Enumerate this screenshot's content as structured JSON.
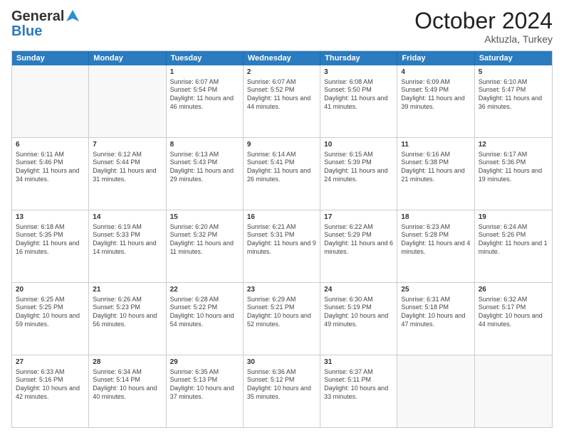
{
  "header": {
    "logo_text_general": "General",
    "logo_text_blue": "Blue",
    "month_title": "October 2024",
    "location": "Aktuzla, Turkey"
  },
  "calendar": {
    "days_of_week": [
      "Sunday",
      "Monday",
      "Tuesday",
      "Wednesday",
      "Thursday",
      "Friday",
      "Saturday"
    ],
    "weeks": [
      [
        {
          "day": "",
          "info": ""
        },
        {
          "day": "",
          "info": ""
        },
        {
          "day": "1",
          "info": "Sunrise: 6:07 AM\nSunset: 5:54 PM\nDaylight: 11 hours and 46 minutes."
        },
        {
          "day": "2",
          "info": "Sunrise: 6:07 AM\nSunset: 5:52 PM\nDaylight: 11 hours and 44 minutes."
        },
        {
          "day": "3",
          "info": "Sunrise: 6:08 AM\nSunset: 5:50 PM\nDaylight: 11 hours and 41 minutes."
        },
        {
          "day": "4",
          "info": "Sunrise: 6:09 AM\nSunset: 5:49 PM\nDaylight: 11 hours and 39 minutes."
        },
        {
          "day": "5",
          "info": "Sunrise: 6:10 AM\nSunset: 5:47 PM\nDaylight: 11 hours and 36 minutes."
        }
      ],
      [
        {
          "day": "6",
          "info": "Sunrise: 6:11 AM\nSunset: 5:46 PM\nDaylight: 11 hours and 34 minutes."
        },
        {
          "day": "7",
          "info": "Sunrise: 6:12 AM\nSunset: 5:44 PM\nDaylight: 11 hours and 31 minutes."
        },
        {
          "day": "8",
          "info": "Sunrise: 6:13 AM\nSunset: 5:43 PM\nDaylight: 11 hours and 29 minutes."
        },
        {
          "day": "9",
          "info": "Sunrise: 6:14 AM\nSunset: 5:41 PM\nDaylight: 11 hours and 26 minutes."
        },
        {
          "day": "10",
          "info": "Sunrise: 6:15 AM\nSunset: 5:39 PM\nDaylight: 11 hours and 24 minutes."
        },
        {
          "day": "11",
          "info": "Sunrise: 6:16 AM\nSunset: 5:38 PM\nDaylight: 11 hours and 21 minutes."
        },
        {
          "day": "12",
          "info": "Sunrise: 6:17 AM\nSunset: 5:36 PM\nDaylight: 11 hours and 19 minutes."
        }
      ],
      [
        {
          "day": "13",
          "info": "Sunrise: 6:18 AM\nSunset: 5:35 PM\nDaylight: 11 hours and 16 minutes."
        },
        {
          "day": "14",
          "info": "Sunrise: 6:19 AM\nSunset: 5:33 PM\nDaylight: 11 hours and 14 minutes."
        },
        {
          "day": "15",
          "info": "Sunrise: 6:20 AM\nSunset: 5:32 PM\nDaylight: 11 hours and 11 minutes."
        },
        {
          "day": "16",
          "info": "Sunrise: 6:21 AM\nSunset: 5:31 PM\nDaylight: 11 hours and 9 minutes."
        },
        {
          "day": "17",
          "info": "Sunrise: 6:22 AM\nSunset: 5:29 PM\nDaylight: 11 hours and 6 minutes."
        },
        {
          "day": "18",
          "info": "Sunrise: 6:23 AM\nSunset: 5:28 PM\nDaylight: 11 hours and 4 minutes."
        },
        {
          "day": "19",
          "info": "Sunrise: 6:24 AM\nSunset: 5:26 PM\nDaylight: 11 hours and 1 minute."
        }
      ],
      [
        {
          "day": "20",
          "info": "Sunrise: 6:25 AM\nSunset: 5:25 PM\nDaylight: 10 hours and 59 minutes."
        },
        {
          "day": "21",
          "info": "Sunrise: 6:26 AM\nSunset: 5:23 PM\nDaylight: 10 hours and 56 minutes."
        },
        {
          "day": "22",
          "info": "Sunrise: 6:28 AM\nSunset: 5:22 PM\nDaylight: 10 hours and 54 minutes."
        },
        {
          "day": "23",
          "info": "Sunrise: 6:29 AM\nSunset: 5:21 PM\nDaylight: 10 hours and 52 minutes."
        },
        {
          "day": "24",
          "info": "Sunrise: 6:30 AM\nSunset: 5:19 PM\nDaylight: 10 hours and 49 minutes."
        },
        {
          "day": "25",
          "info": "Sunrise: 6:31 AM\nSunset: 5:18 PM\nDaylight: 10 hours and 47 minutes."
        },
        {
          "day": "26",
          "info": "Sunrise: 6:32 AM\nSunset: 5:17 PM\nDaylight: 10 hours and 44 minutes."
        }
      ],
      [
        {
          "day": "27",
          "info": "Sunrise: 6:33 AM\nSunset: 5:16 PM\nDaylight: 10 hours and 42 minutes."
        },
        {
          "day": "28",
          "info": "Sunrise: 6:34 AM\nSunset: 5:14 PM\nDaylight: 10 hours and 40 minutes."
        },
        {
          "day": "29",
          "info": "Sunrise: 6:35 AM\nSunset: 5:13 PM\nDaylight: 10 hours and 37 minutes."
        },
        {
          "day": "30",
          "info": "Sunrise: 6:36 AM\nSunset: 5:12 PM\nDaylight: 10 hours and 35 minutes."
        },
        {
          "day": "31",
          "info": "Sunrise: 6:37 AM\nSunset: 5:11 PM\nDaylight: 10 hours and 33 minutes."
        },
        {
          "day": "",
          "info": ""
        },
        {
          "day": "",
          "info": ""
        }
      ]
    ]
  }
}
